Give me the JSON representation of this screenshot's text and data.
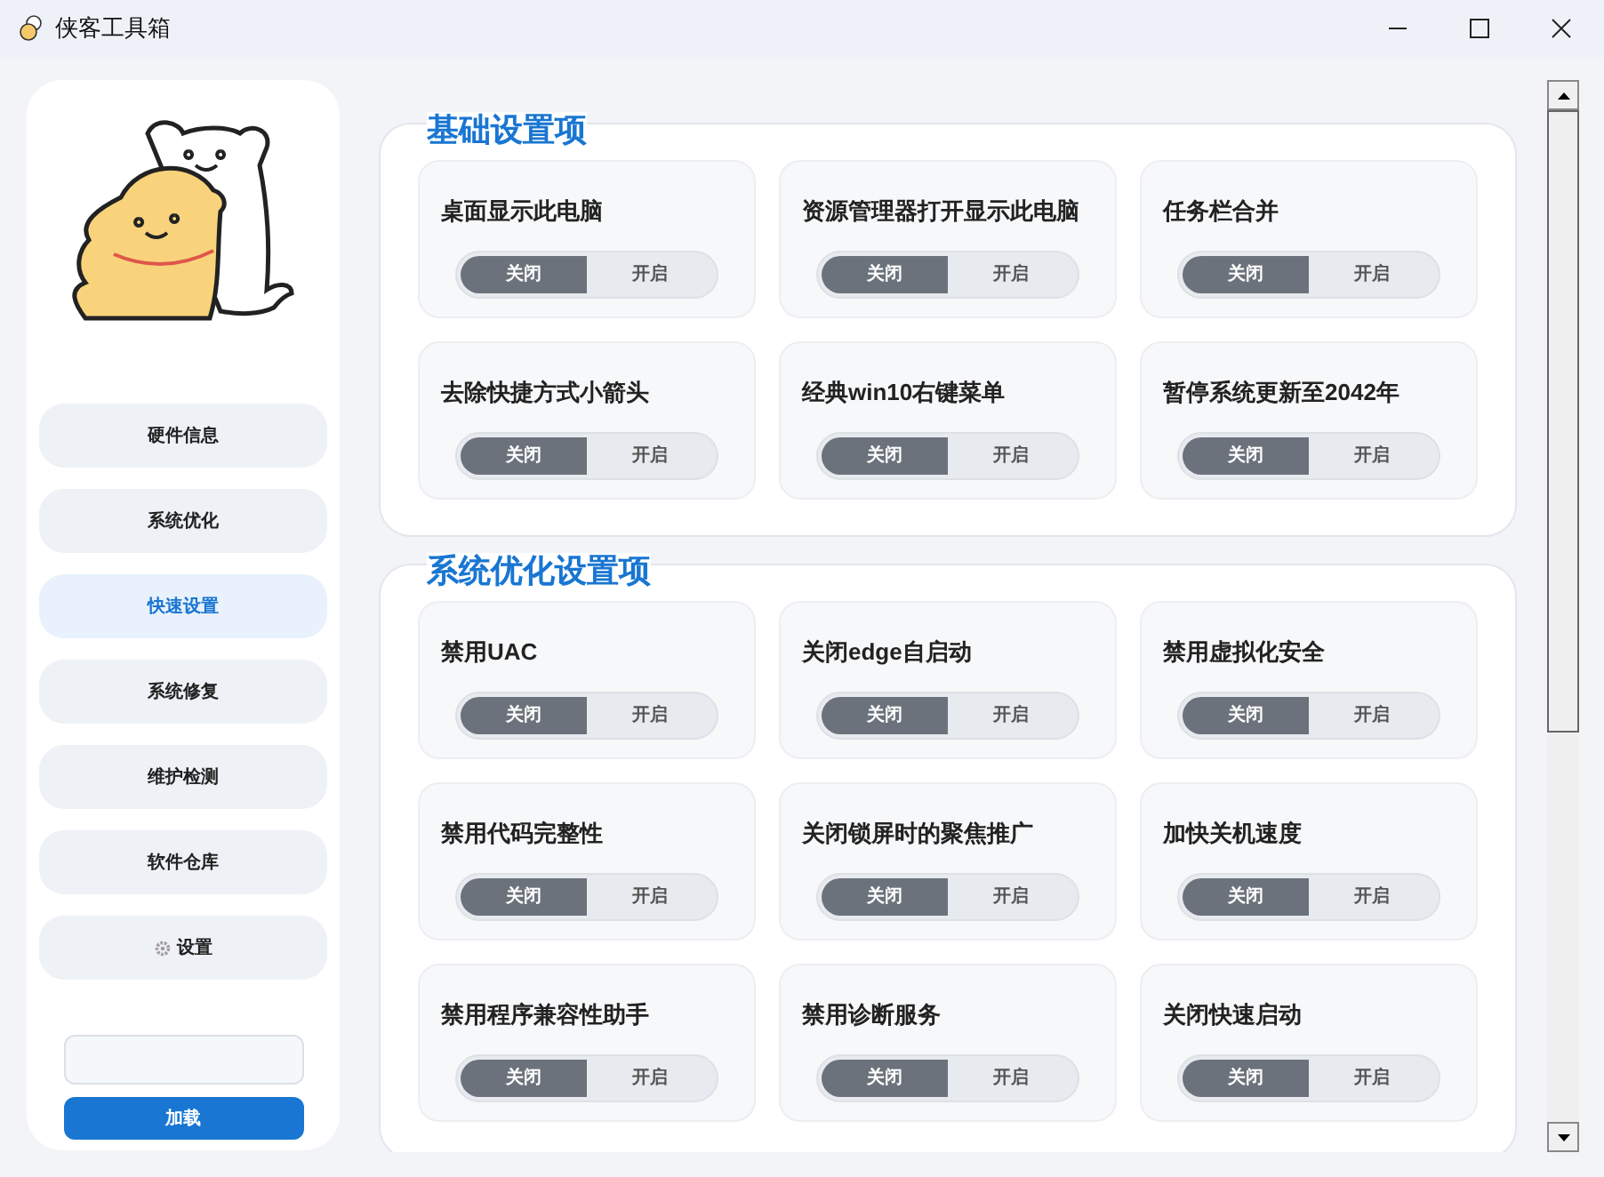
{
  "window": {
    "title": "侠客工具箱"
  },
  "sidebar": {
    "items": [
      {
        "label": "硬件信息",
        "selected": false,
        "kind": "text"
      },
      {
        "label": "系统优化",
        "selected": false,
        "kind": "text"
      },
      {
        "label": "快速设置",
        "selected": true,
        "kind": "text"
      },
      {
        "label": "系统修复",
        "selected": false,
        "kind": "text"
      },
      {
        "label": "维护检测",
        "selected": false,
        "kind": "text"
      },
      {
        "label": "软件仓库",
        "selected": false,
        "kind": "text"
      },
      {
        "label": "设置",
        "selected": false,
        "kind": "settings"
      }
    ],
    "load_button": "加载"
  },
  "sections": [
    {
      "title": "基础设置项",
      "items": [
        {
          "label": "桌面显示此电脑",
          "off_label": "关闭",
          "on_label": "开启",
          "on": false
        },
        {
          "label": "资源管理器打开显示此电脑",
          "off_label": "关闭",
          "on_label": "开启",
          "on": false
        },
        {
          "label": "任务栏合并",
          "off_label": "关闭",
          "on_label": "开启",
          "on": false
        },
        {
          "label": "去除快捷方式小箭头",
          "off_label": "关闭",
          "on_label": "开启",
          "on": false
        },
        {
          "label": "经典win10右键菜单",
          "off_label": "关闭",
          "on_label": "开启",
          "on": false
        },
        {
          "label": "暂停系统更新至2042年",
          "off_label": "关闭",
          "on_label": "开启",
          "on": false
        }
      ]
    },
    {
      "title": "系统优化设置项",
      "items": [
        {
          "label": "禁用UAC",
          "off_label": "关闭",
          "on_label": "开启",
          "on": false
        },
        {
          "label": "关闭edge自启动",
          "off_label": "关闭",
          "on_label": "开启",
          "on": false
        },
        {
          "label": "禁用虚拟化安全",
          "off_label": "关闭",
          "on_label": "开启",
          "on": false
        },
        {
          "label": "禁用代码完整性",
          "off_label": "关闭",
          "on_label": "开启",
          "on": false
        },
        {
          "label": "关闭锁屏时的聚焦推广",
          "off_label": "关闭",
          "on_label": "开启",
          "on": false
        },
        {
          "label": "加快关机速度",
          "off_label": "关闭",
          "on_label": "开启",
          "on": false
        },
        {
          "label": "禁用程序兼容性助手",
          "off_label": "关闭",
          "on_label": "开启",
          "on": false
        },
        {
          "label": "禁用诊断服务",
          "off_label": "关闭",
          "on_label": "开启",
          "on": false
        },
        {
          "label": "关闭快速启动",
          "off_label": "关闭",
          "on_label": "开启",
          "on": false
        }
      ]
    }
  ]
}
